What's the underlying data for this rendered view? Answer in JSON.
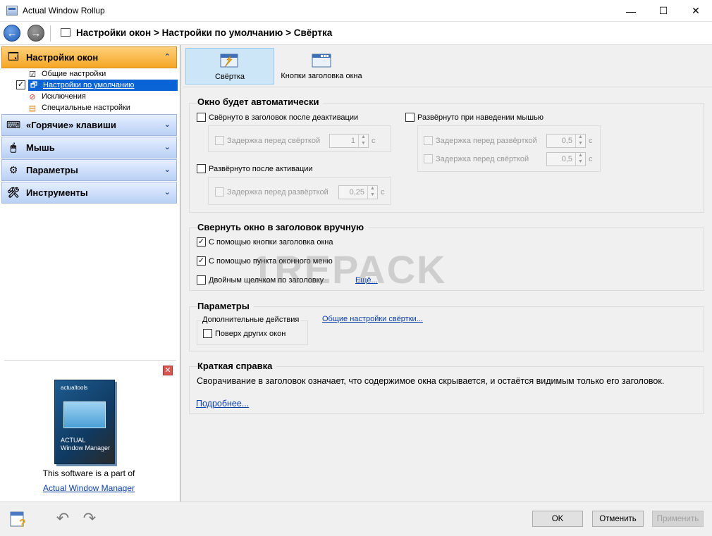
{
  "window": {
    "title": "Actual Window Rollup"
  },
  "window_controls": {
    "minimize": "—",
    "maximize": "☐",
    "close": "✕"
  },
  "nav": {
    "back": "←",
    "forward": "→",
    "breadcrumb": "Настройки окон > Настройки по умолчанию > Свёртка"
  },
  "sidebar": {
    "groups": [
      {
        "label": "Настройки окон",
        "state": "expanded",
        "icon": "window-settings-icon"
      },
      {
        "label": "«Горячие» клавиши",
        "state": "collapsed",
        "icon": "keyboard-icon"
      },
      {
        "label": "Мышь",
        "state": "collapsed",
        "icon": "mouse-icon"
      },
      {
        "label": "Параметры",
        "state": "collapsed",
        "icon": "options-icon"
      },
      {
        "label": "Инструменты",
        "state": "collapsed",
        "icon": "tools-icon"
      }
    ],
    "subitems": [
      {
        "label": "Общие настройки"
      },
      {
        "label": "Настройки по умолчанию",
        "checked": true,
        "selected": true
      },
      {
        "label": "Исключения"
      },
      {
        "label": "Специальные настройки"
      }
    ],
    "chevron_up": "⌃",
    "chevron_down": "⌄"
  },
  "promo": {
    "close": "✕",
    "brand": "actualtools",
    "product_box_line1": "ACTUAL",
    "product_box_line2": "Window Manager",
    "text": "This software is a part of",
    "link": "Actual Window Manager"
  },
  "tabs": [
    {
      "label": "Свёртка",
      "active": true,
      "icon": "rollup-icon"
    },
    {
      "label": "Кнопки заголовка окна",
      "active": false,
      "icon": "title-buttons-icon"
    }
  ],
  "auto": {
    "title": "Окно будет автоматически",
    "rolled_after_deactivate": "Свёрнуто в заголовок после деактивации",
    "rolled_after_deactivate_checked": false,
    "delay_before_rollup": "Задержка перед свёрткой",
    "delay_before_rollup_value": "1",
    "unit_s": "с",
    "unrolled_after_activate": "Развёрнуто после активации",
    "unrolled_after_activate_checked": false,
    "delay_before_unroll": "Задержка перед развёрткой",
    "delay_before_unroll_value": "0,25",
    "unrolled_on_hover": "Развёрнуто при наведении мышью",
    "unrolled_on_hover_checked": false,
    "hover_delay_unroll": "Задержка перед развёрткой",
    "hover_delay_unroll_value": "0,5",
    "hover_delay_rollup": "Задержка перед свёрткой",
    "hover_delay_rollup_value": "0,5"
  },
  "manual": {
    "title": "Свернуть окно в заголовок вручную",
    "by_title_button": "С помощью кнопки заголовка окна",
    "by_title_button_checked": true,
    "by_window_menu": "С помощью пункта оконного меню",
    "by_window_menu_checked": true,
    "by_double_click": "Двойным щелчком по заголовку",
    "by_double_click_checked": false,
    "more_link": "Ещё..."
  },
  "params": {
    "title": "Параметры",
    "extra_actions": "Дополнительные действия",
    "on_top": "Поверх других окон",
    "on_top_checked": false,
    "general_link": "Общие настройки свёртки..."
  },
  "help": {
    "title": "Краткая справка",
    "text": "Сворачивание в заголовок означает, что содержимое окна скрывается, и остаётся видимым только его заголовок.",
    "more_link": "Подробнее..."
  },
  "watermark": "1REPACK",
  "buttons": {
    "ok": "OK",
    "cancel": "Отменить",
    "apply": "Применить"
  },
  "colors": {
    "accent_selected": "#0a64d6",
    "active_group": "#f5a623",
    "link": "#0b3fa8"
  }
}
